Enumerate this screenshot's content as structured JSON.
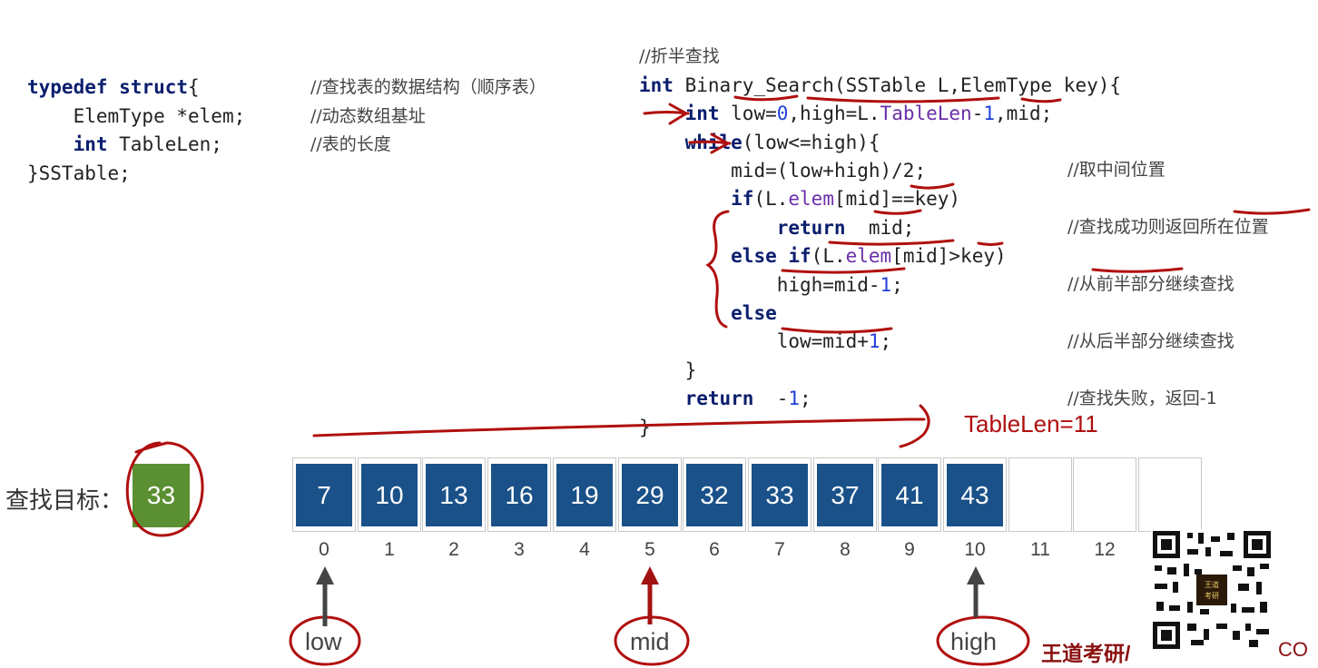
{
  "struct_code": {
    "line1_kw": "typedef struct",
    "line1_rest": "{",
    "line2_type": "ElemType",
    "line2_rest": " *elem;",
    "line3_kw": "int",
    "line3_rest": " TableLen;",
    "line4": "}SSTable;",
    "comment1": "//查找表的数据结构（顺序表）",
    "comment2": "//动态数组基址",
    "comment3": "//表的长度"
  },
  "search_code": {
    "comment_title": "//折半查找",
    "sig_kw": "int",
    "sig_rest": " Binary_Search(SSTable L,ElemType key){",
    "decl_kw": "int",
    "decl_a": " low=",
    "decl_zero": "0",
    "decl_b": ",high=L.",
    "decl_field": "TableLen",
    "decl_c": "-",
    "decl_one": "1",
    "decl_d": ",mid;",
    "while_kw": "while",
    "while_rest": "(low<=high){",
    "mid_line": "mid=(low+high)/2;",
    "if_kw": "if",
    "if_a": "(L.",
    "if_field": "elem",
    "if_b": "[mid]==key)",
    "ret_kw": "return",
    "ret_rest": "  mid;",
    "elseif_kw": "else if",
    "elseif_a": "(L.",
    "elseif_field": "elem",
    "elseif_b": "[mid]>key)",
    "high_a": "high=mid-",
    "high_one": "1",
    "high_b": ";",
    "else_kw": "else",
    "low_a": "low=mid+",
    "low_one": "1",
    "low_b": ";",
    "close_brace": "}",
    "ret2_kw": "return",
    "ret2_rest": "  -",
    "ret2_one": "1",
    "ret2_semi": ";",
    "final_brace": "}",
    "cm_mid": "//取中间位置",
    "cm_found": "//查找成功则返回所在位置",
    "cm_front": "//从前半部分继续查找",
    "cm_back": "//从后半部分继续查找",
    "cm_fail": "//查找失败，返回-1"
  },
  "array": {
    "values": [
      "7",
      "10",
      "13",
      "16",
      "19",
      "29",
      "32",
      "33",
      "37",
      "41",
      "43",
      "",
      "",
      ""
    ],
    "indices": [
      "0",
      "1",
      "2",
      "3",
      "4",
      "5",
      "6",
      "7",
      "8",
      "9",
      "10",
      "11",
      "12"
    ],
    "table_len_label": "TableLen=11"
  },
  "target": {
    "label": "查找目标：",
    "value": "33",
    "color": "#5a8f32"
  },
  "pointers": {
    "low": "low",
    "mid": "mid",
    "high": "high"
  },
  "watermark": {
    "text": "王道考研/",
    "tail": "CO",
    "qr_badge": "王道考研"
  },
  "colors": {
    "cell": "#1a5189",
    "annotation_red": "#b00f0f",
    "mid_arrow": "#a31212",
    "pointer_arrow": "#444444"
  }
}
